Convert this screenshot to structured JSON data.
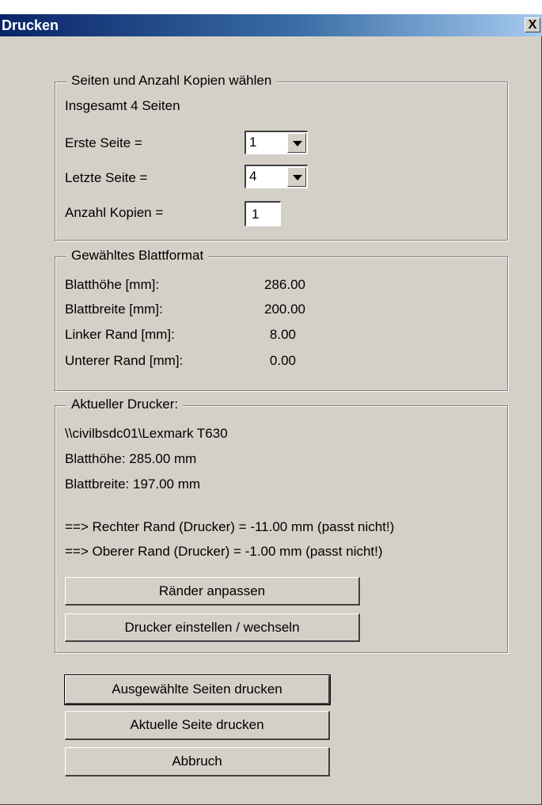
{
  "window": {
    "title": "Drucken",
    "close_glyph": "X"
  },
  "pages_group": {
    "legend": "Seiten und Anzahl Kopien wählen",
    "total_text": "Insgesamt 4 Seiten",
    "first_page_label": "Erste Seite =",
    "first_page_value": "1",
    "last_page_label": "Letzte Seite =",
    "last_page_value": "4",
    "copies_label": "Anzahl Kopien =",
    "copies_value": "1"
  },
  "format_group": {
    "legend": "Gewähltes Blattformat",
    "rows": [
      {
        "label": "Blatthöhe [mm]:",
        "value": "286.00"
      },
      {
        "label": "Blattbreite [mm]:",
        "value": "200.00"
      },
      {
        "label": "Linker Rand [mm]:",
        "value": "8.00"
      },
      {
        "label": "Unterer Rand [mm]:",
        "value": "0.00"
      }
    ]
  },
  "printer_group": {
    "legend": "Aktueller Drucker:",
    "printer_name": "\\\\civilbsdc01\\Lexmark T630",
    "height_text": "Blatthöhe:  285.00 mm",
    "width_text": "Blattbreite: 197.00 mm",
    "warning_right": "==> Rechter Rand (Drucker) = -11.00 mm  (passt nicht!)",
    "warning_top": "==> Oberer Rand (Drucker) = -1.00 mm  (passt nicht!)",
    "adjust_button": "Ränder anpassen",
    "setup_button": "Drucker einstellen / wechseln"
  },
  "actions": {
    "print_selected": "Ausgewählte Seiten drucken",
    "print_current": "Aktuelle Seite drucken",
    "cancel": "Abbruch"
  },
  "colors": {
    "dialog_bg": "#d4d0c8",
    "title_start": "#0a246a",
    "title_end": "#a6caf0"
  }
}
